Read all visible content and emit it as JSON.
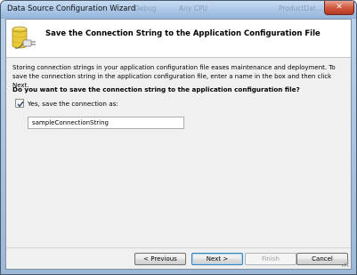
{
  "window": {
    "title": "Data Source Configuration Wizard",
    "background_tabs": [
      "Debug",
      "Any CPU",
      "ProductDat..."
    ],
    "close_glyph": "✕"
  },
  "header": {
    "title": "Save the Connection String to the Application Configuration File",
    "icon": "database-connection-icon"
  },
  "body": {
    "description": "Storing connection strings in your application configuration file eases maintenance and deployment. To save the connection string in the application configuration file, enter a name in the box and then click Next.",
    "question": "Do you want to save the connection string to the application configuration file?",
    "save_checkbox": {
      "label": "Yes, save the connection as:",
      "checked": true
    },
    "connection_name": {
      "value": "sampleConnectionString"
    }
  },
  "buttons": {
    "previous": "< Previous",
    "next": "Next >",
    "finish": "Finish",
    "cancel": "Cancel"
  },
  "colors": {
    "titlebar": "#a9c6e6",
    "dialog_background": "#f0f0f0",
    "header_background": "#ffffff",
    "default_button_border": "#3c7fb1"
  }
}
